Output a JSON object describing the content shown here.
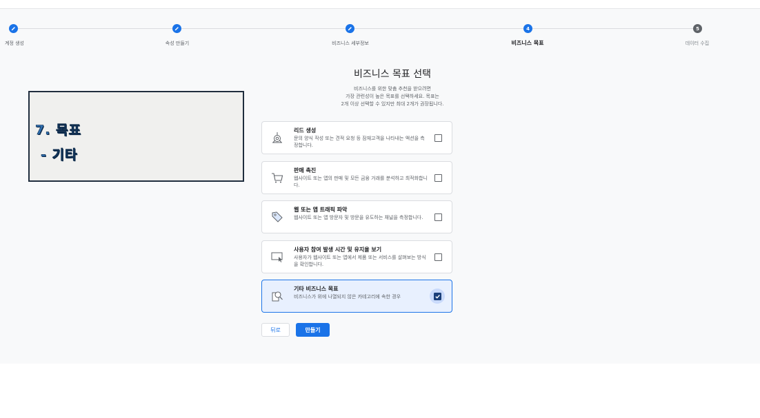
{
  "stepper": {
    "steps": [
      {
        "label": "계정 생성",
        "state": "done",
        "icon": "pencil-icon"
      },
      {
        "label": "속성 만들기",
        "state": "done",
        "icon": "pencil-icon"
      },
      {
        "label": "비즈니스 세부정보",
        "state": "done",
        "icon": "pencil-icon"
      },
      {
        "label": "비즈니스 목표",
        "state": "active",
        "number": "4"
      },
      {
        "label": "데이터 수집",
        "state": "pending",
        "number": "5"
      }
    ]
  },
  "annotation": {
    "line1": "7. 목표",
    "line2": "- 기타"
  },
  "main": {
    "title": "비즈니스 목표 선택",
    "desc_line1": "비즈니스를 위한 맞춤 추천을 받으려면",
    "desc_line2": "가장 관련성이 높은 목표를 선택하세요. 목표는",
    "desc_line3": "2개 이상 선택할 수 있지만 최대 2개가 권장됩니다."
  },
  "goals": [
    {
      "title": "리드 생성",
      "desc": "문의 양식 작성 또는 견적 요청 등 잠재고객을 나타내는 액션을 측정합니다.",
      "checked": false,
      "icon": "lead-target-icon"
    },
    {
      "title": "판매 촉진",
      "desc": "웹사이트 또는 앱의 판매 및 모든 금융 거래를 분석하고 최적화합니다.",
      "checked": false,
      "icon": "shopping-cart-icon"
    },
    {
      "title": "웹 또는 앱 트래픽 파악",
      "desc": "웹사이트 또는 앱 방문자 및 방문을 유도하는 채널을 측정합니다.",
      "checked": false,
      "icon": "tag-icon"
    },
    {
      "title": "사용자 참여 발생 시간 및 유지율 보기",
      "desc": "사용자가 웹사이트 또는 앱에서 제품 또는 서비스를 살펴보는 방식을 확인합니다.",
      "checked": false,
      "icon": "screen-cursor-icon"
    },
    {
      "title": "기타 비즈니스 목표",
      "desc": "비즈니스가 위에 나열되지 않은 카테고리에 속한 경우",
      "checked": true,
      "icon": "magnifier-icon"
    }
  ],
  "buttons": {
    "back": "뒤로",
    "create": "만들기"
  },
  "colors": {
    "accent": "#1a73e8",
    "selected_bg": "#e8f0fe",
    "annotation_text": "#2f6fb0"
  }
}
